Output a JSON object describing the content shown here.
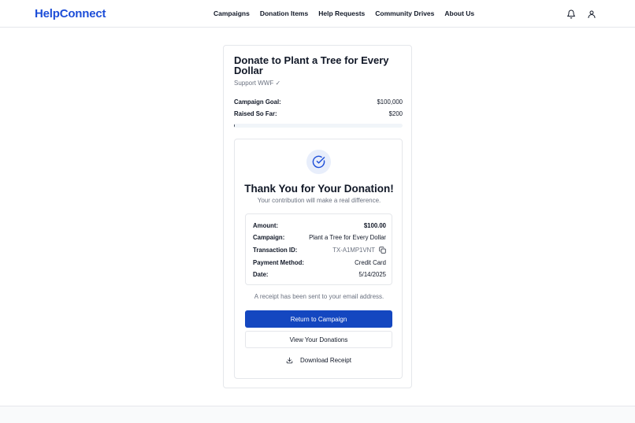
{
  "header": {
    "logo": "HelpConnect",
    "nav": [
      "Campaigns",
      "Donation Items",
      "Help Requests",
      "Community Drives",
      "About Us"
    ],
    "icons": [
      "bell-icon",
      "user-icon"
    ]
  },
  "campaign": {
    "title": "Donate to Plant a Tree for Every Dollar",
    "subtitle": "Support WWF ✓",
    "goal_label": "Campaign Goal:",
    "goal_value": "$100,000",
    "raised_label": "Raised So Far:",
    "raised_value": "$200",
    "progress_fraction": 0.002
  },
  "success": {
    "icon": "check-circle-icon",
    "title": "Thank You for Your Donation!",
    "subtitle": "Your contribution will make a real difference.",
    "details": {
      "amount_label": "Amount:",
      "amount_value": "$100.00",
      "campaign_label": "Campaign:",
      "campaign_value": "Plant a Tree for Every Dollar",
      "txn_label": "Transaction ID:",
      "txn_value": "TX-A1MP1VNT",
      "method_label": "Payment Method:",
      "method_value": "Credit Card",
      "date_label": "Date:",
      "date_value": "5/14/2025"
    },
    "receipt_note": "A receipt has been sent to your email address.",
    "return_button": "Return to Campaign",
    "view_button": "View Your Donations",
    "download_button": "Download Receipt"
  },
  "colors": {
    "brand": "#1d4ed8",
    "primary_button": "#1447c0",
    "muted_text": "#6b7280"
  }
}
